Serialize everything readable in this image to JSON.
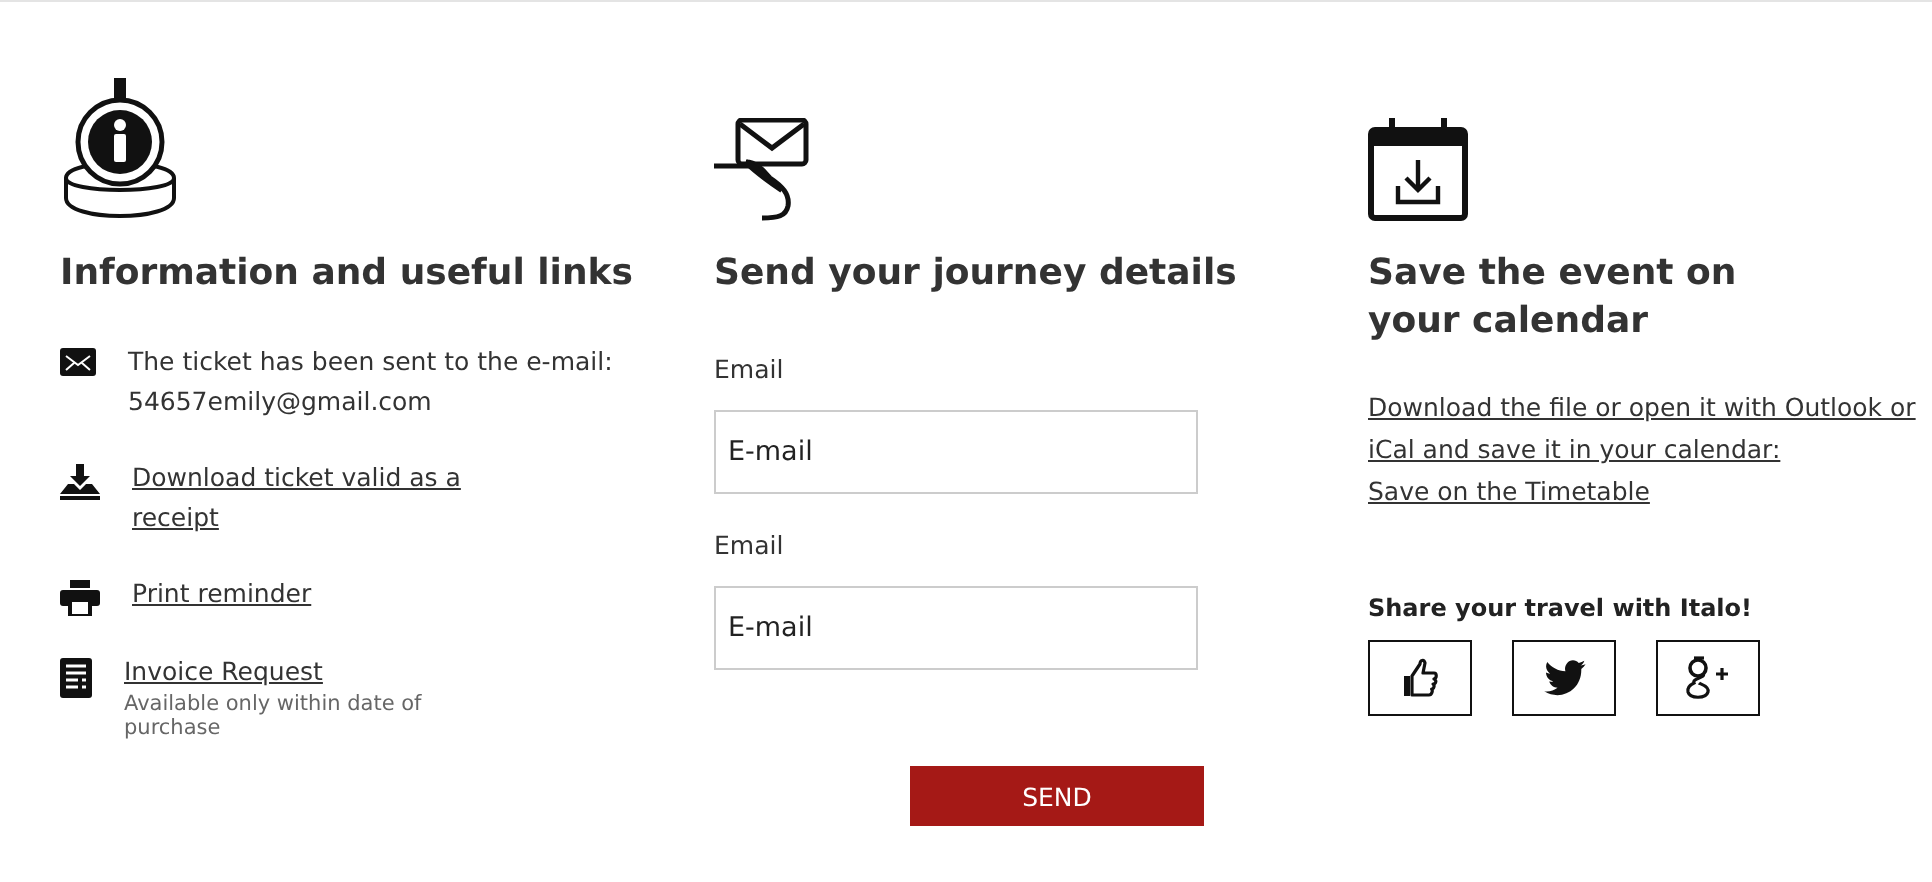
{
  "info": {
    "heading": "Information and useful links",
    "items": [
      {
        "kind": "email",
        "text": "The ticket has been sent to the e-mail:",
        "value": "54657emily@gmail.com"
      },
      {
        "kind": "download",
        "link": "Download ticket valid as a receipt"
      },
      {
        "kind": "print",
        "link": "Print reminder"
      },
      {
        "kind": "invoice",
        "link": "Invoice Request",
        "note": "Available only within date of purchase"
      }
    ]
  },
  "send": {
    "heading": "Send your journey details",
    "fields": [
      {
        "label": "Email",
        "placeholder": "E-mail"
      },
      {
        "label": "Email",
        "placeholder": "E-mail"
      }
    ],
    "button": "SEND"
  },
  "calendar": {
    "heading": "Save the event on your calendar",
    "link": "Download the file or open it with Outlook or iCal and save it in your calendar:",
    "timetable_link": "Save on the Timetable",
    "share_label": "Share your travel with Italo!",
    "share_buttons": [
      {
        "kind": "like"
      },
      {
        "kind": "twitter"
      },
      {
        "kind": "gplus"
      }
    ]
  }
}
